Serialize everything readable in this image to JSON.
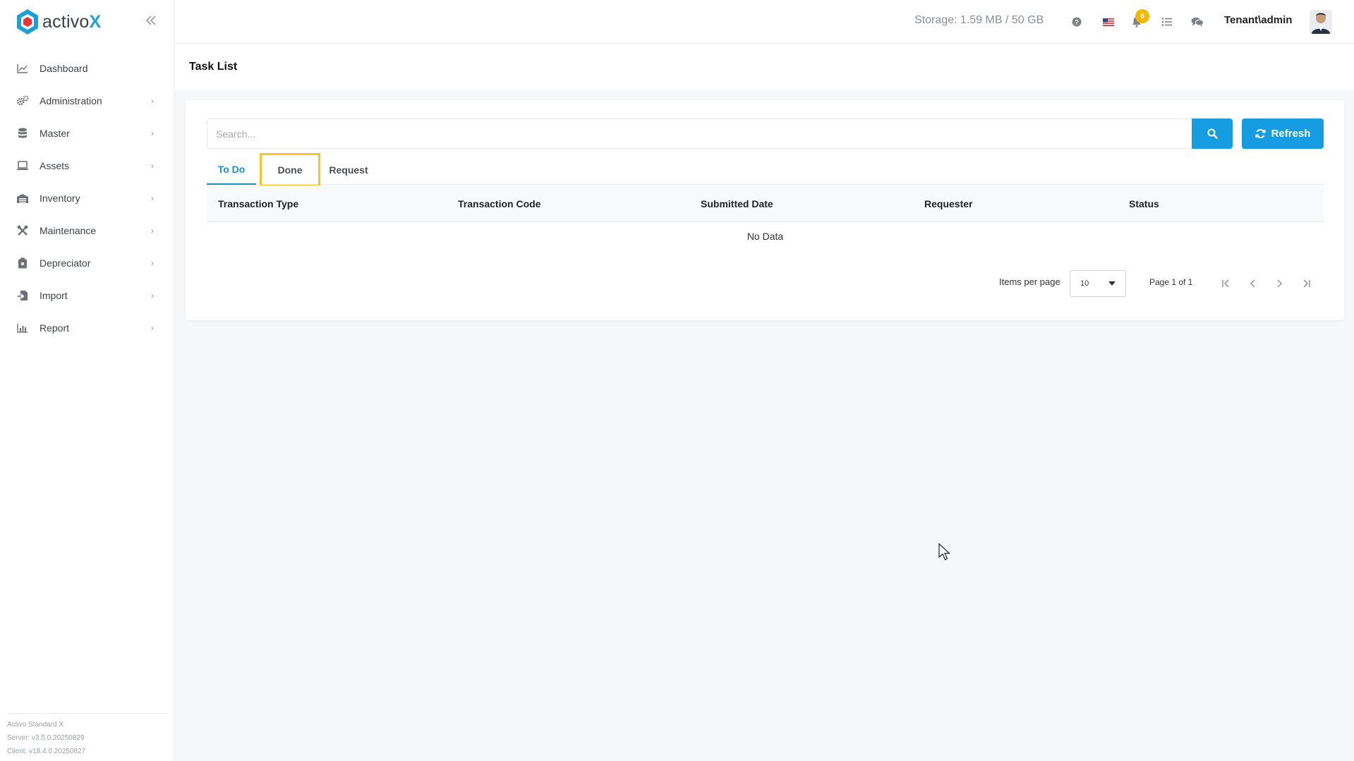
{
  "brand": {
    "name": "activo",
    "suffix": "X",
    "accent": "#1f9fd8"
  },
  "sidebar": {
    "items": [
      {
        "label": "Dashboard",
        "icon": "chart-line-icon",
        "has_children": false
      },
      {
        "label": "Administration",
        "icon": "gears-icon",
        "has_children": true
      },
      {
        "label": "Master",
        "icon": "database-icon",
        "has_children": true
      },
      {
        "label": "Assets",
        "icon": "laptop-icon",
        "has_children": true
      },
      {
        "label": "Inventory",
        "icon": "warehouse-icon",
        "has_children": true
      },
      {
        "label": "Maintenance",
        "icon": "tools-icon",
        "has_children": true
      },
      {
        "label": "Depreciator",
        "icon": "clipboard-icon",
        "has_children": true
      },
      {
        "label": "Import",
        "icon": "file-import-icon",
        "has_children": true
      },
      {
        "label": "Report",
        "icon": "chart-bar-icon",
        "has_children": true
      }
    ],
    "footer": {
      "product": "Activo Standard X",
      "server": "Server: v3.5.0.20250829",
      "client": "Client: v18.4.0.20250827"
    }
  },
  "topbar": {
    "storage": "Storage: 1.59 MB / 50 GB",
    "notifications_count": "6",
    "user": "Tenant\\admin"
  },
  "page": {
    "title": "Task List"
  },
  "search": {
    "placeholder": "Search..."
  },
  "refresh_label": "Refresh",
  "tabs": [
    {
      "label": "To Do",
      "active": true
    },
    {
      "label": "Done",
      "active": false,
      "highlighted": true
    },
    {
      "label": "Request",
      "active": false
    }
  ],
  "table": {
    "columns": [
      "Transaction Type",
      "Transaction Code",
      "Submitted Date",
      "Requester",
      "Status"
    ],
    "empty_text": "No Data"
  },
  "pagination": {
    "items_per_page_label": "Items per page",
    "items_per_page": "10",
    "page_text": "Page 1 of 1"
  },
  "colors": {
    "primary": "#169ce0",
    "highlight": "#f7c52b",
    "badge": "#f5b800"
  }
}
